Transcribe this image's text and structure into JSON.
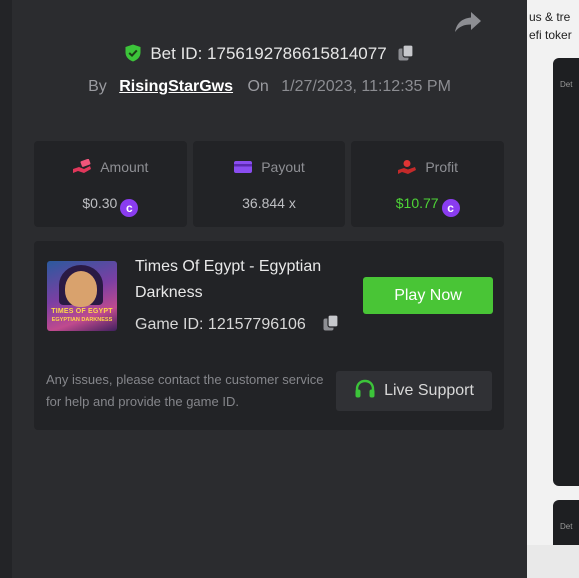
{
  "bet": {
    "label": "Bet ID:",
    "id": "1756192786615814077",
    "by_label": "By",
    "user": "RisingStarGws",
    "on_label": "On",
    "date": "1/27/2023, 11:12:35 PM"
  },
  "stats": {
    "amount": {
      "label": "Amount",
      "value": "$0.30"
    },
    "payout": {
      "label": "Payout",
      "value": "36.844 x"
    },
    "profit": {
      "label": "Profit",
      "value": "$10.77"
    }
  },
  "game": {
    "title": "Times Of Egypt - Egyptian Darkness",
    "id_label": "Game ID:",
    "id": "12157796106",
    "thumb_line1": "TIMES OF EGYPT",
    "thumb_line2": "EGYPTIAN DARKNESS",
    "play_label": "Play Now",
    "issues_text": "Any issues, please contact the customer service for help and provide the game ID.",
    "support_label": "Live Support"
  },
  "background": {
    "line1": "us & tre",
    "line2": "efi toker",
    "card_label": "Det"
  },
  "colors": {
    "accent_green": "#49c536",
    "profit_green": "#4ed437",
    "coin_purple": "#8a3cf0",
    "modal_bg": "#2b2c2f",
    "panel_bg": "#222326"
  },
  "icons": {
    "share": "share-arrow-icon",
    "shield": "shield-check-icon",
    "copy": "copy-icon",
    "amount": "money-hand-icon",
    "payout": "wallet-card-icon",
    "profit": "profit-hand-icon",
    "coin": "coin-icon",
    "support": "headset-icon"
  }
}
